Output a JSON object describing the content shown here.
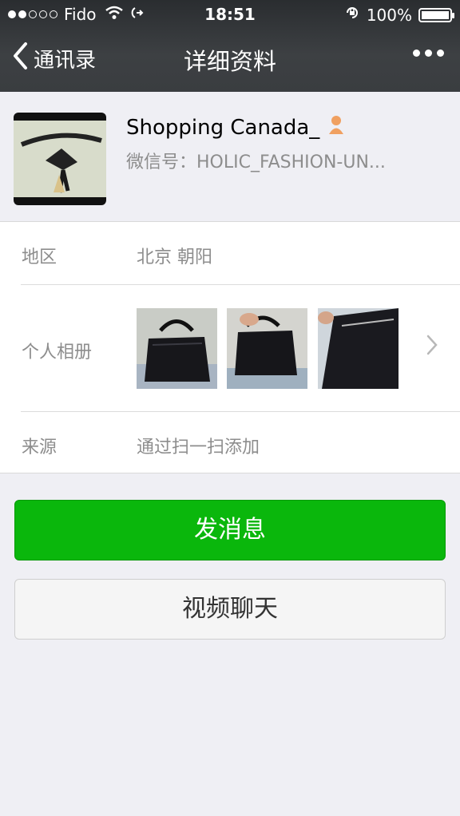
{
  "status_bar": {
    "carrier": "Fido",
    "time": "18:51",
    "battery": "100%"
  },
  "nav": {
    "back_label": "通讯录",
    "title": "详细资料"
  },
  "profile": {
    "name": "Shopping Canada_",
    "wechat_id": "微信号：HOLIC_FASHION-UN..."
  },
  "info": {
    "region_label": "地区",
    "region_value": "北京 朝阳",
    "album_label": "个人相册",
    "source_label": "来源",
    "source_value": "通过扫一扫添加"
  },
  "actions": {
    "message_label": "发消息",
    "video_label": "视频聊天"
  },
  "colors": {
    "primary_button": "#0ab70c",
    "nav_bar": "#3a3d40"
  },
  "icons": [
    "signal-dots-icon",
    "wifi-icon",
    "location-arrow-icon",
    "rotation-lock-icon",
    "battery-icon",
    "back-chevron-icon",
    "more-icon",
    "gender-female-icon",
    "chevron-right-icon"
  ]
}
